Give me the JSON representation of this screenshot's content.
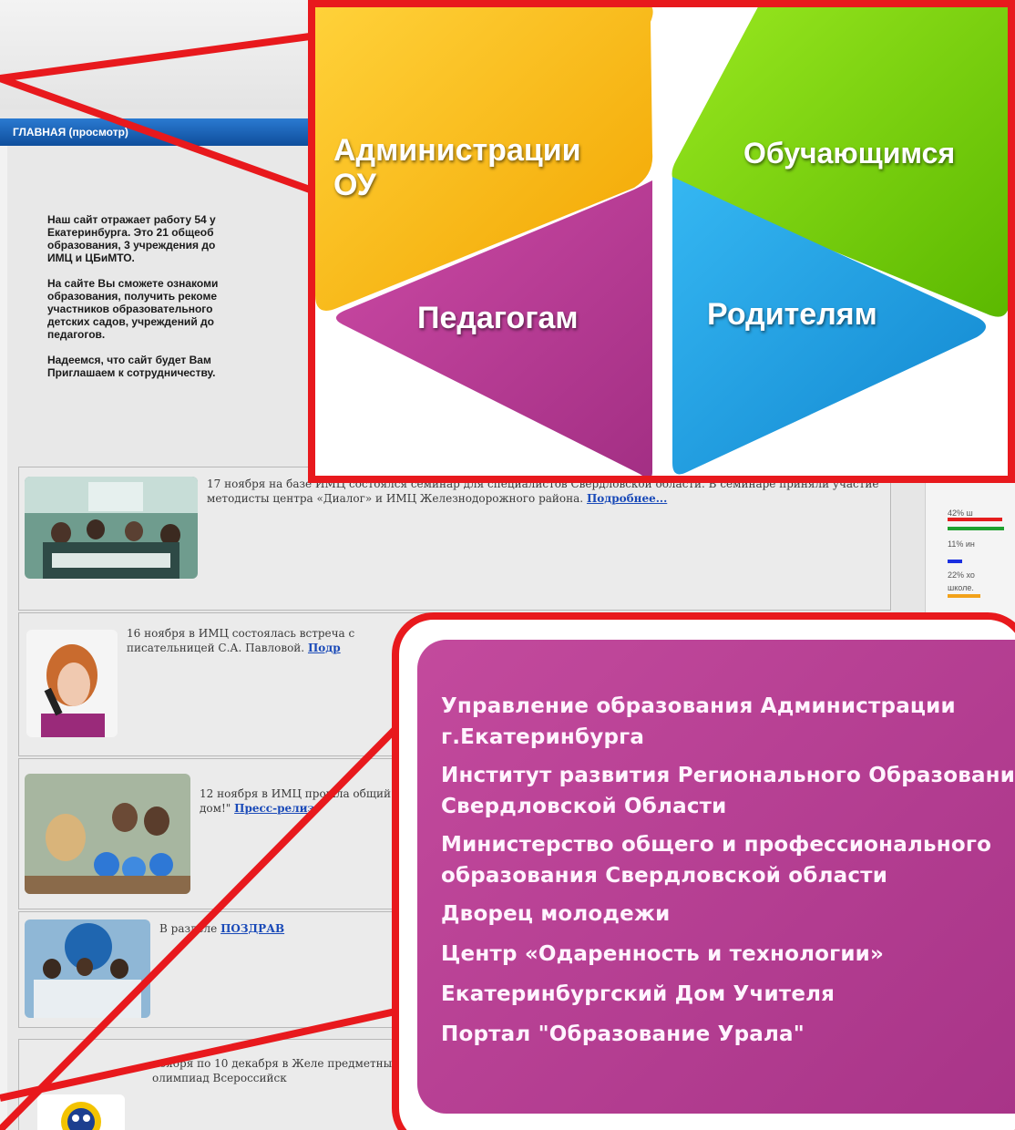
{
  "site": {
    "header_title": "ГЛАВНАЯ (просмотр)",
    "intro": [
      "Наш сайт отражает работу 54 у",
      "Екатеринбурга. Это 21 общеоб",
      "образования, 3 учреждения до",
      "ИМЦ и ЦБиМТО.",
      "",
      "На сайте Вы сможете ознакоми",
      "образования, получить рекоме",
      "участников образовательного",
      "детских садов, учреждений до",
      "педагогов.",
      "",
      "Надеемся, что сайт будет Вам",
      "Приглашаем к сотрудничеству."
    ],
    "news": [
      {
        "text": "17 ноября на базе ИМЦ состоялся семинар для специалистов Свердловской области. В семинаре приняли участие методисты центра «Диалог» и ИМЦ Железнодорожного района.",
        "link": "Подробнее..."
      },
      {
        "text": "16 ноября в ИМЦ состоялась встреча с писательницей С.А. Павловой.",
        "link": "Подр"
      },
      {
        "text": "12 ноября в ИМЦ прошла общий дом!\"",
        "link": "Пресс-релиз"
      },
      {
        "text": "В разделе",
        "link": "ПОЗДРАВ"
      },
      {
        "text": "ноября по 10 декабря в Желе предметных олимпиад Всероссийск",
        "link": ""
      }
    ],
    "poll": [
      {
        "label": "42%  ш",
        "color": "#1fa12f"
      },
      {
        "label": "11%  ин",
        "color": "#1a2fe0"
      },
      {
        "label": "22%  хо",
        "color": "#f2a21a"
      }
    ],
    "poll_trailer": "школе."
  },
  "menu": {
    "administration": "Администрации\nОУ",
    "students": "Обучающимся",
    "teachers": "Педагогам",
    "parents": "Родителям",
    "colors": {
      "administration": "#f7b500",
      "students": "#7cd000",
      "teachers": "#b8378f",
      "parents": "#1ea0e3"
    }
  },
  "links": {
    "items": [
      "Управление образования Администрации",
      "г.Екатеринбурга",
      "Институт развития Регионального Образования",
      "Свердловской Области",
      "Министерство общего и профессионального",
      "образования Свердловской области",
      "Дворец молодежи",
      "Центр «Одаренность и технологии»",
      "Екатеринбургский Дом Учителя",
      "Портал \"Образование Урала\""
    ]
  },
  "accent_color": "#e8191d"
}
